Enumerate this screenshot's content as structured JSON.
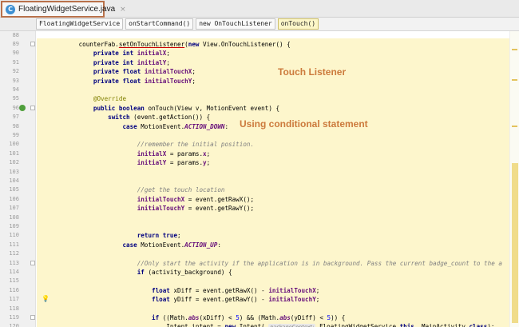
{
  "tab": {
    "icon": "C",
    "label": "FloatingWidgetService.java",
    "close": "×"
  },
  "breadcrumbs": [
    "FloatingWidgetService",
    "onStartCommand()",
    "new OnTouchListener",
    "onTouch()"
  ],
  "annotations": {
    "touch_listener": "Touch Listener",
    "conditional": "Using conditional statement"
  },
  "lines": [
    {
      "n": "88",
      "t": []
    },
    {
      "n": "89",
      "t": [
        [
          "",
          "        counterFab."
        ],
        [
          "code-ul",
          "setOnTouchListener"
        ],
        [
          "",
          "("
        ],
        [
          "kw",
          "new"
        ],
        [
          "",
          " View.OnTouchListener() {"
        ]
      ]
    },
    {
      "n": "90",
      "t": [
        [
          "",
          "            "
        ],
        [
          "kw",
          "private int "
        ],
        [
          "fld",
          "initialX"
        ],
        [
          "",
          ";"
        ]
      ]
    },
    {
      "n": "91",
      "t": [
        [
          "",
          "            "
        ],
        [
          "kw",
          "private int "
        ],
        [
          "fld",
          "initialY"
        ],
        [
          "",
          ";"
        ]
      ]
    },
    {
      "n": "92",
      "t": [
        [
          "",
          "            "
        ],
        [
          "kw",
          "private float "
        ],
        [
          "fld",
          "initialTouchX"
        ],
        [
          "",
          ";"
        ]
      ]
    },
    {
      "n": "93",
      "t": [
        [
          "",
          "            "
        ],
        [
          "kw",
          "private float "
        ],
        [
          "fld",
          "initialTouchY"
        ],
        [
          "",
          ";"
        ]
      ]
    },
    {
      "n": "94",
      "t": []
    },
    {
      "n": "95",
      "t": [
        [
          "",
          "            "
        ],
        [
          "an",
          "@Override"
        ]
      ]
    },
    {
      "n": "96",
      "t": [
        [
          "",
          "            "
        ],
        [
          "kw",
          "public boolean "
        ],
        [
          "",
          "onTouch(View v, MotionEvent event) {"
        ]
      ]
    },
    {
      "n": "97",
      "t": [
        [
          "",
          "                "
        ],
        [
          "kw",
          "switch "
        ],
        [
          "",
          "(event.getAction()) {"
        ]
      ]
    },
    {
      "n": "98",
      "t": [
        [
          "",
          "                    "
        ],
        [
          "kw",
          "case "
        ],
        [
          "",
          "MotionEvent."
        ],
        [
          "st",
          "ACTION_DOWN"
        ],
        [
          "",
          ":"
        ]
      ]
    },
    {
      "n": "99",
      "t": []
    },
    {
      "n": "100",
      "t": [
        [
          "",
          "                        "
        ],
        [
          "cm",
          "//remember the initial position."
        ]
      ]
    },
    {
      "n": "101",
      "t": [
        [
          "",
          "                        "
        ],
        [
          "fld",
          "initialX"
        ],
        [
          "",
          " = params."
        ],
        [
          "fld",
          "x"
        ],
        [
          "",
          ";"
        ]
      ]
    },
    {
      "n": "102",
      "t": [
        [
          "",
          "                        "
        ],
        [
          "fld",
          "initialY"
        ],
        [
          "",
          " = params."
        ],
        [
          "fld",
          "y"
        ],
        [
          "",
          ";"
        ]
      ]
    },
    {
      "n": "103",
      "t": []
    },
    {
      "n": "104",
      "t": []
    },
    {
      "n": "105",
      "t": [
        [
          "",
          "                        "
        ],
        [
          "cm",
          "//get the touch location"
        ]
      ]
    },
    {
      "n": "106",
      "t": [
        [
          "",
          "                        "
        ],
        [
          "fld",
          "initialTouchX"
        ],
        [
          "",
          " = event.getRawX();"
        ]
      ]
    },
    {
      "n": "107",
      "t": [
        [
          "",
          "                        "
        ],
        [
          "fld",
          "initialTouchY"
        ],
        [
          "",
          " = event.getRawY();"
        ]
      ]
    },
    {
      "n": "108",
      "t": []
    },
    {
      "n": "109",
      "t": []
    },
    {
      "n": "110",
      "t": [
        [
          "",
          "                        "
        ],
        [
          "kw",
          "return true"
        ],
        [
          "",
          ";"
        ]
      ]
    },
    {
      "n": "111",
      "t": [
        [
          "",
          "                    "
        ],
        [
          "kw",
          "case "
        ],
        [
          "",
          "MotionEvent."
        ],
        [
          "st",
          "ACTION_UP"
        ],
        [
          "",
          ":"
        ]
      ]
    },
    {
      "n": "112",
      "t": []
    },
    {
      "n": "113",
      "t": [
        [
          "",
          "                        "
        ],
        [
          "cm",
          "//Only start the activity if the application is in background. Pass the current badge_count to the a"
        ]
      ]
    },
    {
      "n": "114",
      "t": [
        [
          "",
          "                        "
        ],
        [
          "kw",
          "if "
        ],
        [
          "",
          "(activity_background) {"
        ]
      ]
    },
    {
      "n": "115",
      "t": []
    },
    {
      "n": "116",
      "t": [
        [
          "",
          "                            "
        ],
        [
          "kw",
          "float "
        ],
        [
          "",
          "xDiff = event.getRawX() - "
        ],
        [
          "fld",
          "initialTouchX"
        ],
        [
          "",
          ";"
        ]
      ]
    },
    {
      "n": "117",
      "t": [
        [
          "",
          "                            "
        ],
        [
          "kw",
          "float "
        ],
        [
          "",
          "yDiff = event.getRawY() - "
        ],
        [
          "fld",
          "initialTouchY"
        ],
        [
          "",
          ";"
        ]
      ]
    },
    {
      "n": "118",
      "t": []
    },
    {
      "n": "119",
      "t": [
        [
          "",
          "                            "
        ],
        [
          "kw",
          "if "
        ],
        [
          "",
          "((Math."
        ],
        [
          "st",
          "abs"
        ],
        [
          "",
          "(xDiff) < "
        ],
        [
          "num",
          "5"
        ],
        [
          "",
          ") && (Math."
        ],
        [
          "st",
          "abs"
        ],
        [
          "",
          "(yDiff) < "
        ],
        [
          "num",
          "5"
        ],
        [
          "",
          ")) {"
        ]
      ]
    },
    {
      "n": "120",
      "t": [
        [
          "",
          "                                Intent intent = "
        ],
        [
          "kw",
          "new "
        ],
        [
          "",
          "Intent( "
        ],
        [
          "hint",
          "packageContext:"
        ],
        [
          "",
          " FloatingWidgetService."
        ],
        [
          "kw",
          "this"
        ],
        [
          "",
          ", MainActivity."
        ],
        [
          "kw",
          "class"
        ],
        [
          "",
          ");"
        ]
      ]
    }
  ]
}
